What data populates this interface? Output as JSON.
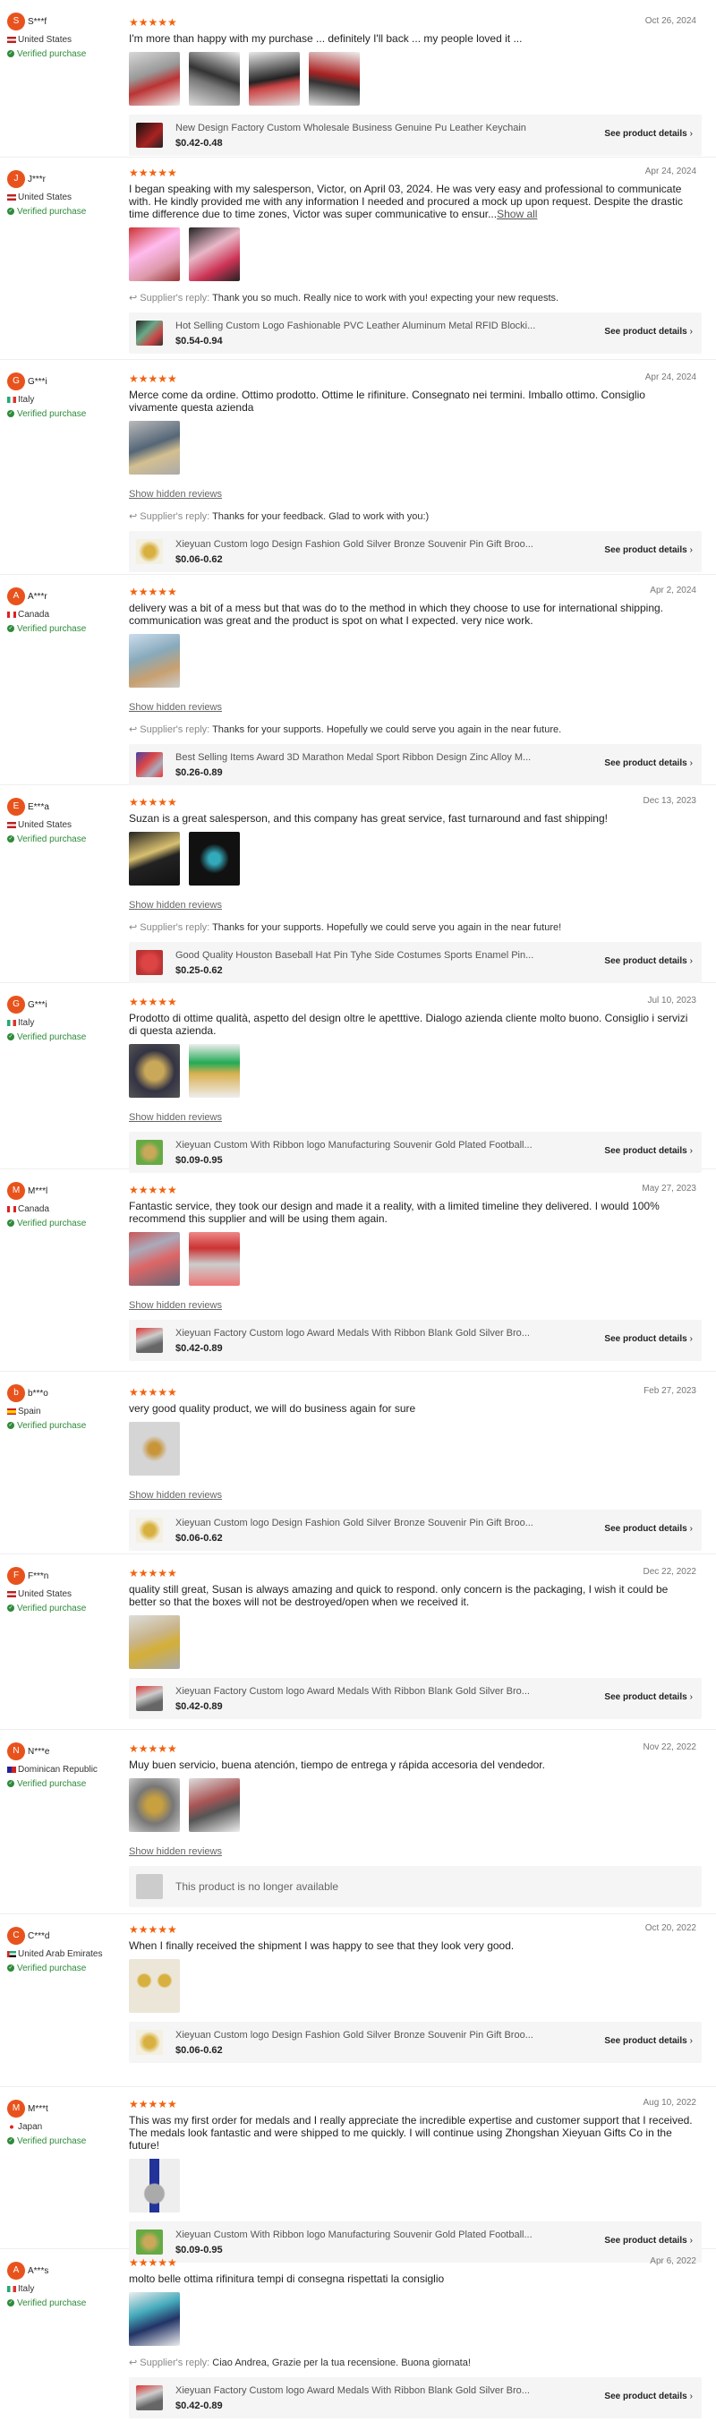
{
  "colors": {
    "accent": "#f2620f",
    "avatar": "#e8531d",
    "verified": "#2e8b3a"
  },
  "labels": {
    "verified": "Verified purchase",
    "see_details": "See product details",
    "show_hidden": "Show hidden reviews",
    "supplier_reply": "Supplier's reply:",
    "unavailable": "This product is no longer available",
    "stars": "★★★★★",
    "show_all": "Show all"
  },
  "reviews": [
    {
      "initial": "S",
      "name": "S***f",
      "country": "United States",
      "date": "Oct 26, 2024",
      "text": "I'm more than happy with my purchase ... definitely I'll back ... my people loved it ...",
      "product": {
        "title": "New Design Factory Custom Wholesale Business Genuine Pu Leather Keychain",
        "price": "$0.42-0.48"
      }
    },
    {
      "initial": "J",
      "name": "J***r",
      "country": "United States",
      "date": "Apr 24, 2024",
      "text": "I began speaking with my salesperson, Victor, on April 03, 2024. He was very easy and professional to communicate with. He kindly provided me with any information I needed and procured a mock up upon request. Despite the drastic time difference due to time zones, Victor was super communicative to ensur...",
      "reply": "Thank you so much. Really nice to work with you! expecting your new requests.",
      "product": {
        "title": "Hot Selling Custom Logo Fashionable PVC Leather Aluminum Metal RFID Blocki...",
        "price": "$0.54-0.94"
      }
    },
    {
      "initial": "G",
      "name": "G***i",
      "country": "Italy",
      "date": "Apr 24, 2024",
      "text": "Merce come da ordine. Ottimo prodotto. Ottime le rifiniture. Consegnato nei termini. Imballo ottimo. Consiglio vivamente questa azienda",
      "reply": "Thanks for your feedback. Glad to work with you:)",
      "product": {
        "title": "Xieyuan Custom logo Design Fashion Gold Silver Bronze Souvenir Pin Gift Broo...",
        "price": "$0.06-0.62"
      }
    },
    {
      "initial": "A",
      "name": "A***r",
      "country": "Canada",
      "date": "Apr 2, 2024",
      "text": "delivery was a bit of a mess but that was do to the method in which they choose to use for international shipping. communication was great and the product is spot on what I expected. very nice work.",
      "reply": "Thanks for your supports. Hopefully we could serve you again in the near future.",
      "product": {
        "title": "Best Selling Items Award 3D Marathon Medal Sport Ribbon Design Zinc Alloy M...",
        "price": "$0.26-0.89"
      }
    },
    {
      "initial": "E",
      "name": "E***a",
      "country": "United States",
      "date": "Dec 13, 2023",
      "text": "Suzan is a great salesperson, and this company has great service, fast turnaround and fast shipping!",
      "reply": "Thanks for your supports. Hopefully we could serve you again in the near future!",
      "product": {
        "title": "Good Quality Houston Baseball Hat Pin Tyhe Side Costumes Sports Enamel Pin...",
        "price": "$0.25-0.62"
      }
    },
    {
      "initial": "G",
      "name": "G***i",
      "country": "Italy",
      "date": "Jul 10, 2023",
      "text": "Prodotto di ottime qualità, aspetto del design oltre le apetttive. Dialogo azienda cliente molto buono. Consiglio i servizi di questa azienda.",
      "product": {
        "title": "Xieyuan Custom With Ribbon logo Manufacturing Souvenir Gold Plated Football...",
        "price": "$0.09-0.95"
      }
    },
    {
      "initial": "M",
      "name": "M***l",
      "country": "Canada",
      "date": "May 27, 2023",
      "text": "Fantastic service, they took our design and made it a reality, with a limited timeline they delivered. I would 100% recommend this supplier and will be using them again.",
      "product": {
        "title": "Xieyuan Factory Custom logo Award Medals With Ribbon Blank Gold Silver Bro...",
        "price": "$0.42-0.89"
      }
    },
    {
      "initial": "b",
      "name": "b***o",
      "country": "Spain",
      "date": "Feb 27, 2023",
      "text": "very good quality product, we will do business again for sure",
      "product": {
        "title": "Xieyuan Custom logo Design Fashion Gold Silver Bronze Souvenir Pin Gift Broo...",
        "price": "$0.06-0.62"
      }
    },
    {
      "initial": "F",
      "name": "F***n",
      "country": "United States",
      "date": "Dec 22, 2022",
      "text": "quality still great, Susan is always amazing and quick to respond. only concern is the packaging, I wish it could be better so that the boxes will not be destroyed/open when we received it.",
      "product": {
        "title": "Xieyuan Factory Custom logo Award Medals With Ribbon Blank Gold Silver Bro...",
        "price": "$0.42-0.89"
      }
    },
    {
      "initial": "N",
      "name": "N***e",
      "country": "Dominican Republic",
      "date": "Nov 22, 2022",
      "text": "Muy buen servicio, buena atención, tiempo de entrega y rápida accesoria del vendedor."
    },
    {
      "initial": "C",
      "name": "C***d",
      "country": "United Arab Emirates",
      "date": "Oct 20, 2022",
      "text": "When I finally received the shipment I was happy to see that they look very good.",
      "product": {
        "title": "Xieyuan Custom logo Design Fashion Gold Silver Bronze Souvenir Pin Gift Broo...",
        "price": "$0.06-0.62"
      }
    },
    {
      "initial": "M",
      "name": "M***t",
      "country": "Japan",
      "date": "Aug 10, 2022",
      "text": "This was my first order for medals and I really appreciate the incredible expertise and customer support that I received. The medals look fantastic and were shipped to me quickly. I will continue using Zhongshan Xieyuan Gifts Co in the future!",
      "product": {
        "title": "Xieyuan Custom With Ribbon logo Manufacturing Souvenir Gold Plated Football...",
        "price": "$0.09-0.95"
      }
    },
    {
      "initial": "A",
      "name": "A***s",
      "country": "Italy",
      "date": "Apr 6, 2022",
      "text": "molto belle ottima rifinitura tempi di consegna rispettati la consiglio",
      "reply": "Ciao Andrea, Grazie per la tua recensione. Buona giornata!",
      "product": {
        "title": "Xieyuan Factory Custom logo Award Medals With Ribbon Blank Gold Silver Bro...",
        "price": "$0.42-0.89"
      }
    }
  ]
}
